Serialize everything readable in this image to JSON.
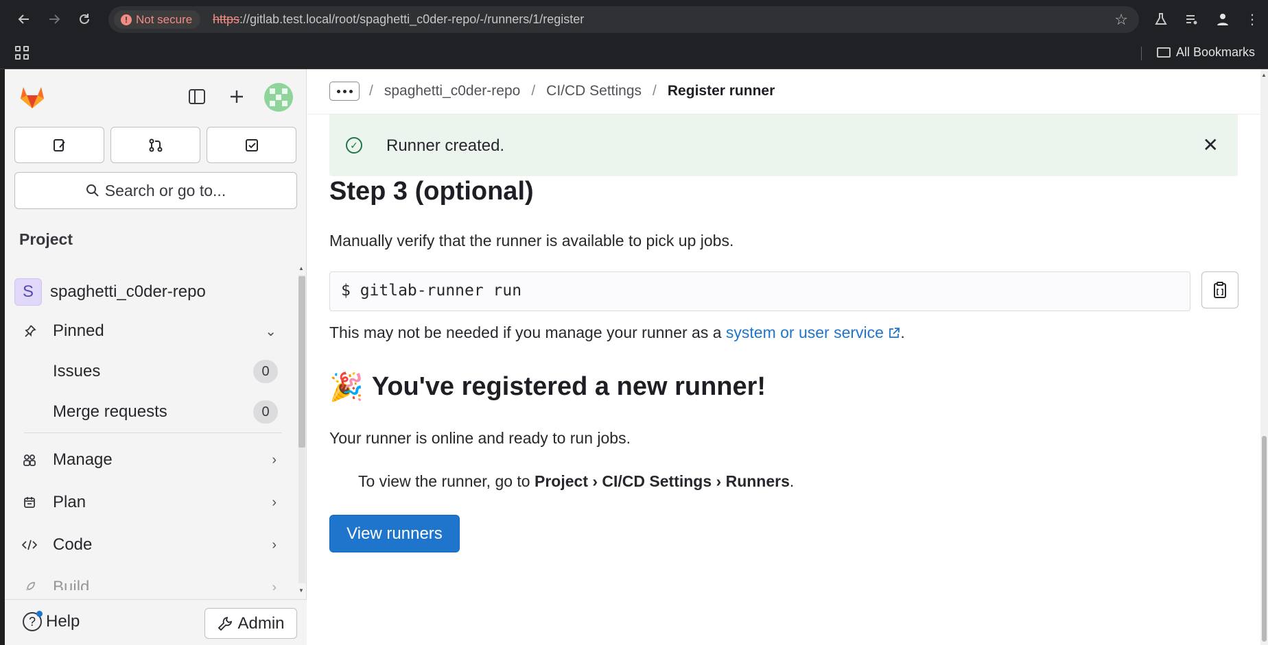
{
  "browser": {
    "security_label": "Not secure",
    "url_scheme": "https",
    "url_rest": "://gitlab.test.local/root/spaghetti_c0der-repo/-/runners/1/register",
    "bookmarks_label": "All Bookmarks"
  },
  "sidebar": {
    "search_placeholder": "Search or go to...",
    "section_title": "Project",
    "project_initial": "S",
    "project_name": "spaghetti_c0der-repo",
    "items": [
      {
        "label": "Pinned"
      },
      {
        "label": "Issues",
        "count": "0"
      },
      {
        "label": "Merge requests",
        "count": "0"
      },
      {
        "label": "Manage"
      },
      {
        "label": "Plan"
      },
      {
        "label": "Code"
      },
      {
        "label": "Build"
      }
    ],
    "help_label": "Help",
    "admin_label": "Admin"
  },
  "breadcrumb": {
    "items": [
      "spaghetti_c0der-repo",
      "CI/CD Settings",
      "Register runner"
    ],
    "separator": "/"
  },
  "alert": {
    "message": "Runner created."
  },
  "content": {
    "step3_title": "Step 3 (optional)",
    "step3_desc": "Manually verify that the runner is available to pick up jobs.",
    "command": "$ gitlab-runner run",
    "service_note_prefix": "This may not be needed if you manage your runner as a ",
    "service_link": "system or user service",
    "service_note_suffix": ".",
    "registered_emoji": "🎉",
    "registered_title": "You've registered a new runner!",
    "online_text": "Your runner is online and ready to run jobs.",
    "view_prefix": "To view the runner, go to ",
    "view_path": "Project › CI/CD Settings › Runners",
    "view_suffix": ".",
    "view_button": "View runners"
  },
  "colors": {
    "primary": "#1f75cb",
    "success": "#217645",
    "alert_bg": "#ecf4ee"
  }
}
